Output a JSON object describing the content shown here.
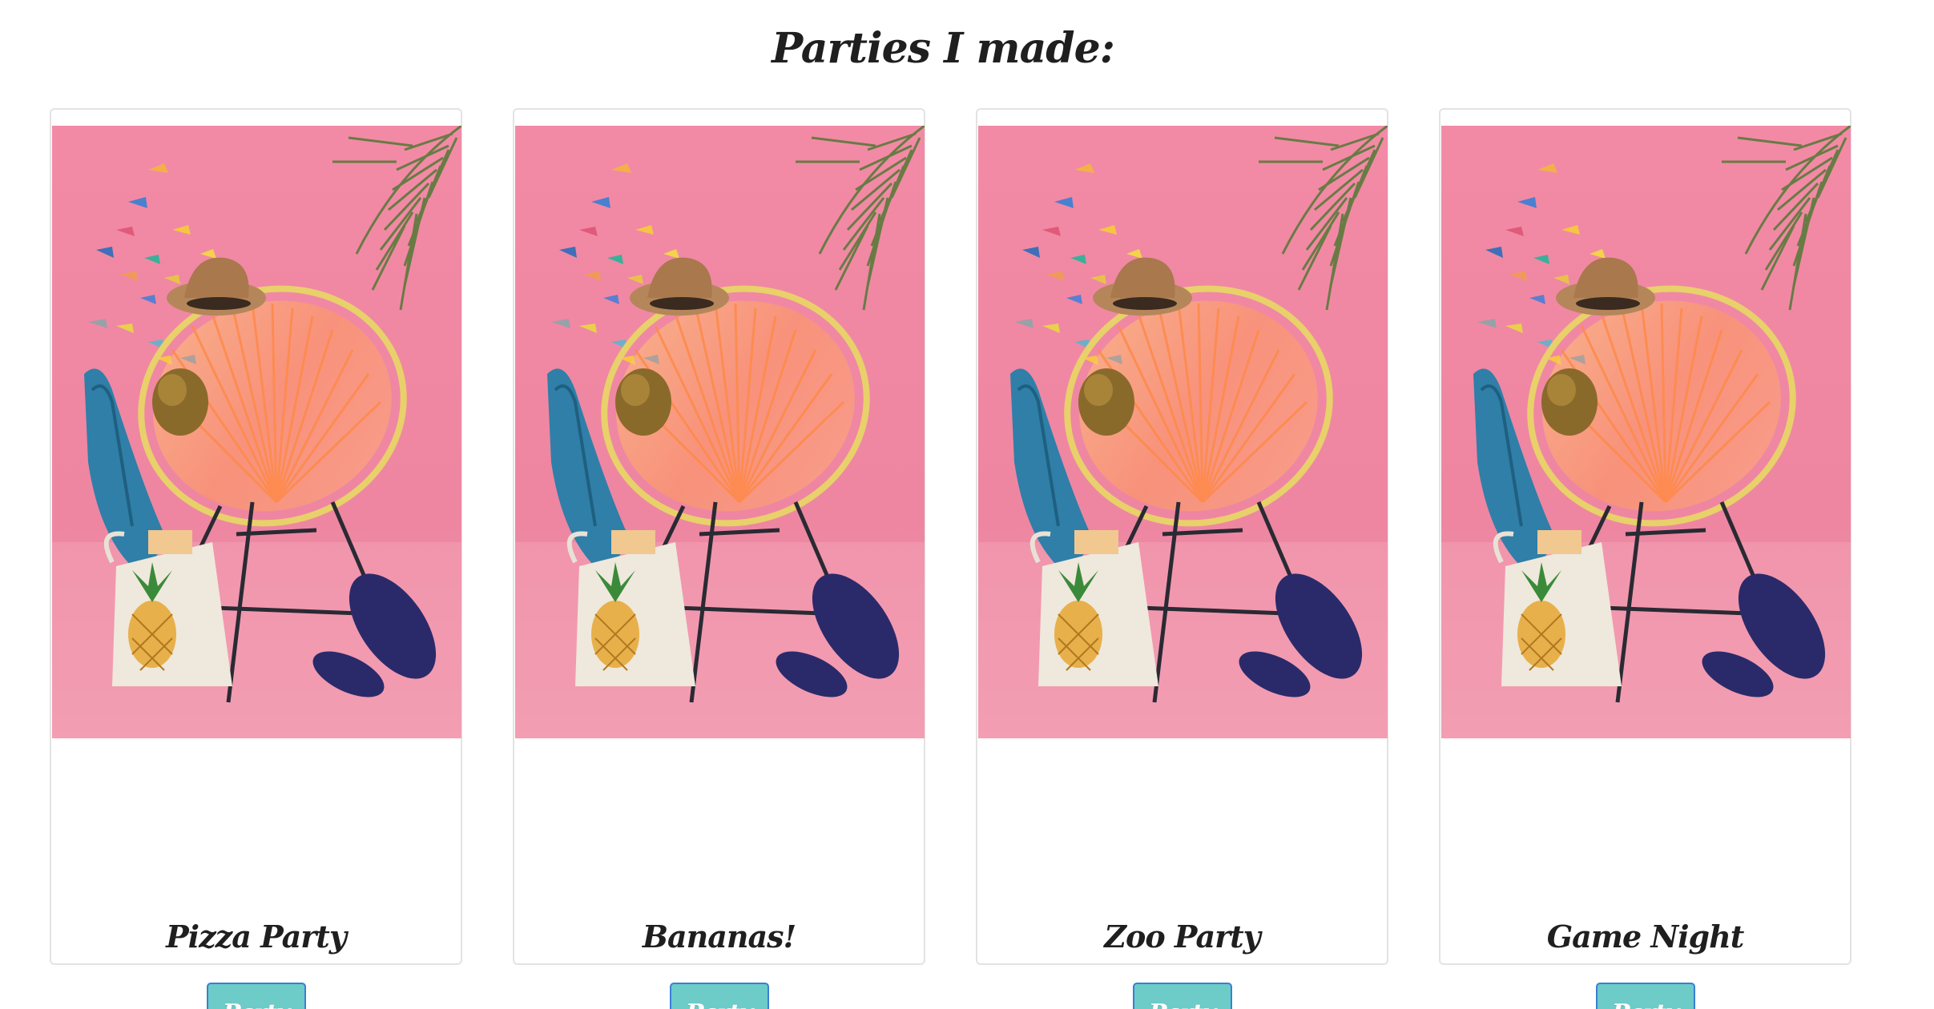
{
  "heading": "Parties I made:",
  "colors": {
    "background_pink": "#f08fa8",
    "button_teal": "#6dcbc8",
    "button_border": "#3a7fd6",
    "title_text": "#1f1f1f"
  },
  "cards": [
    {
      "title": "Pizza Party",
      "button_label": "Party",
      "image": "pink-chair-beach-photo"
    },
    {
      "title": "Bananas!",
      "button_label": "Party",
      "image": "pink-chair-beach-photo"
    },
    {
      "title": "Zoo Party",
      "button_label": "Party",
      "image": "pink-chair-beach-photo"
    },
    {
      "title": "Game Night",
      "button_label": "Party",
      "image": "pink-chair-beach-photo"
    }
  ]
}
